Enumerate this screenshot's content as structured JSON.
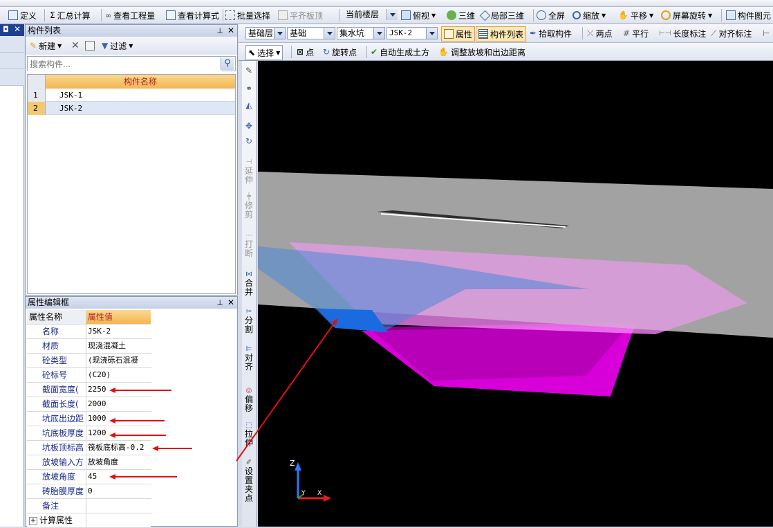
{
  "toolbar1": {
    "define": "定义",
    "sum_calc": "汇总计算",
    "view_quantity": "查看工程量",
    "view_formula": "查看计算式",
    "batch_select": "批量选择",
    "align_slab_top": "平齐板顶",
    "current_floor": "当前楼层",
    "top_view": "俯视",
    "three_d": "三维",
    "local_3d": "局部三维",
    "full_screen": "全屏",
    "zoom": "缩放",
    "pan": "平移",
    "screen_rotate": "屏幕旋转",
    "component_elem": "构件图元"
  },
  "toolbar2": {
    "layer_value": "基础层",
    "category_value": "基础",
    "type_value": "集水坑",
    "component_value": "JSK-2",
    "properties": "属性",
    "component_list": "构件列表",
    "pick_component": "拾取构件",
    "two_points": "两点",
    "parallel": "平行",
    "length_dim": "长度标注",
    "align_dim": "对齐标注"
  },
  "toolbar3": {
    "select": "选择",
    "point": "点",
    "rotate_point": "旋转点",
    "auto_earthwork": "自动生成土方",
    "adjust_slope": "调整放坡和出边距离"
  },
  "component_list": {
    "title": "构件列表",
    "new": "新建",
    "filter": "过滤",
    "search_placeholder": "搜索构件...",
    "column_header": "构件名称",
    "rows": [
      {
        "num": "1",
        "name": "JSK-1"
      },
      {
        "num": "2",
        "name": "JSK-2"
      }
    ]
  },
  "property_editor": {
    "title": "属性编辑框",
    "col_name": "属性名称",
    "col_value": "属性值",
    "rows": [
      {
        "name": "名称",
        "value": "JSK-2"
      },
      {
        "name": "材质",
        "value": "现浇混凝土"
      },
      {
        "name": "砼类型",
        "value": "(现浇砾石混凝"
      },
      {
        "name": "砼标号",
        "value": "(C20)"
      },
      {
        "name": "截面宽度(",
        "value": "2250"
      },
      {
        "name": "截面长度(",
        "value": "2000"
      },
      {
        "name": "坑底出边距",
        "value": "1000"
      },
      {
        "name": "坑底板厚度",
        "value": "1200"
      },
      {
        "name": "坑板顶标高",
        "value": "筏板底标高-0.2"
      },
      {
        "name": "放坡输入方",
        "value": "放坡角度"
      },
      {
        "name": "放坡角度",
        "value": "45"
      },
      {
        "name": "砖胎膜厚度",
        "value": "0"
      },
      {
        "name": "备注",
        "value": ""
      },
      {
        "name": "计算属性",
        "value": ""
      }
    ]
  },
  "side_tools": {
    "extend": "延伸",
    "trim": "修剪",
    "break": "打断",
    "merge": "合并",
    "split": "分割",
    "align": "对齐",
    "offset": "偏移",
    "stretch": "拉伸",
    "set_grip": "设置夹点"
  },
  "viewport": {
    "axis_z": "Z",
    "axis_y": "Y",
    "axis_x": "X"
  },
  "colors": {
    "annotation_arrow": "#e01010",
    "pit_magenta": "#e000e0",
    "viewport_bg": "#000000",
    "header_orange": "#f7c46a"
  }
}
